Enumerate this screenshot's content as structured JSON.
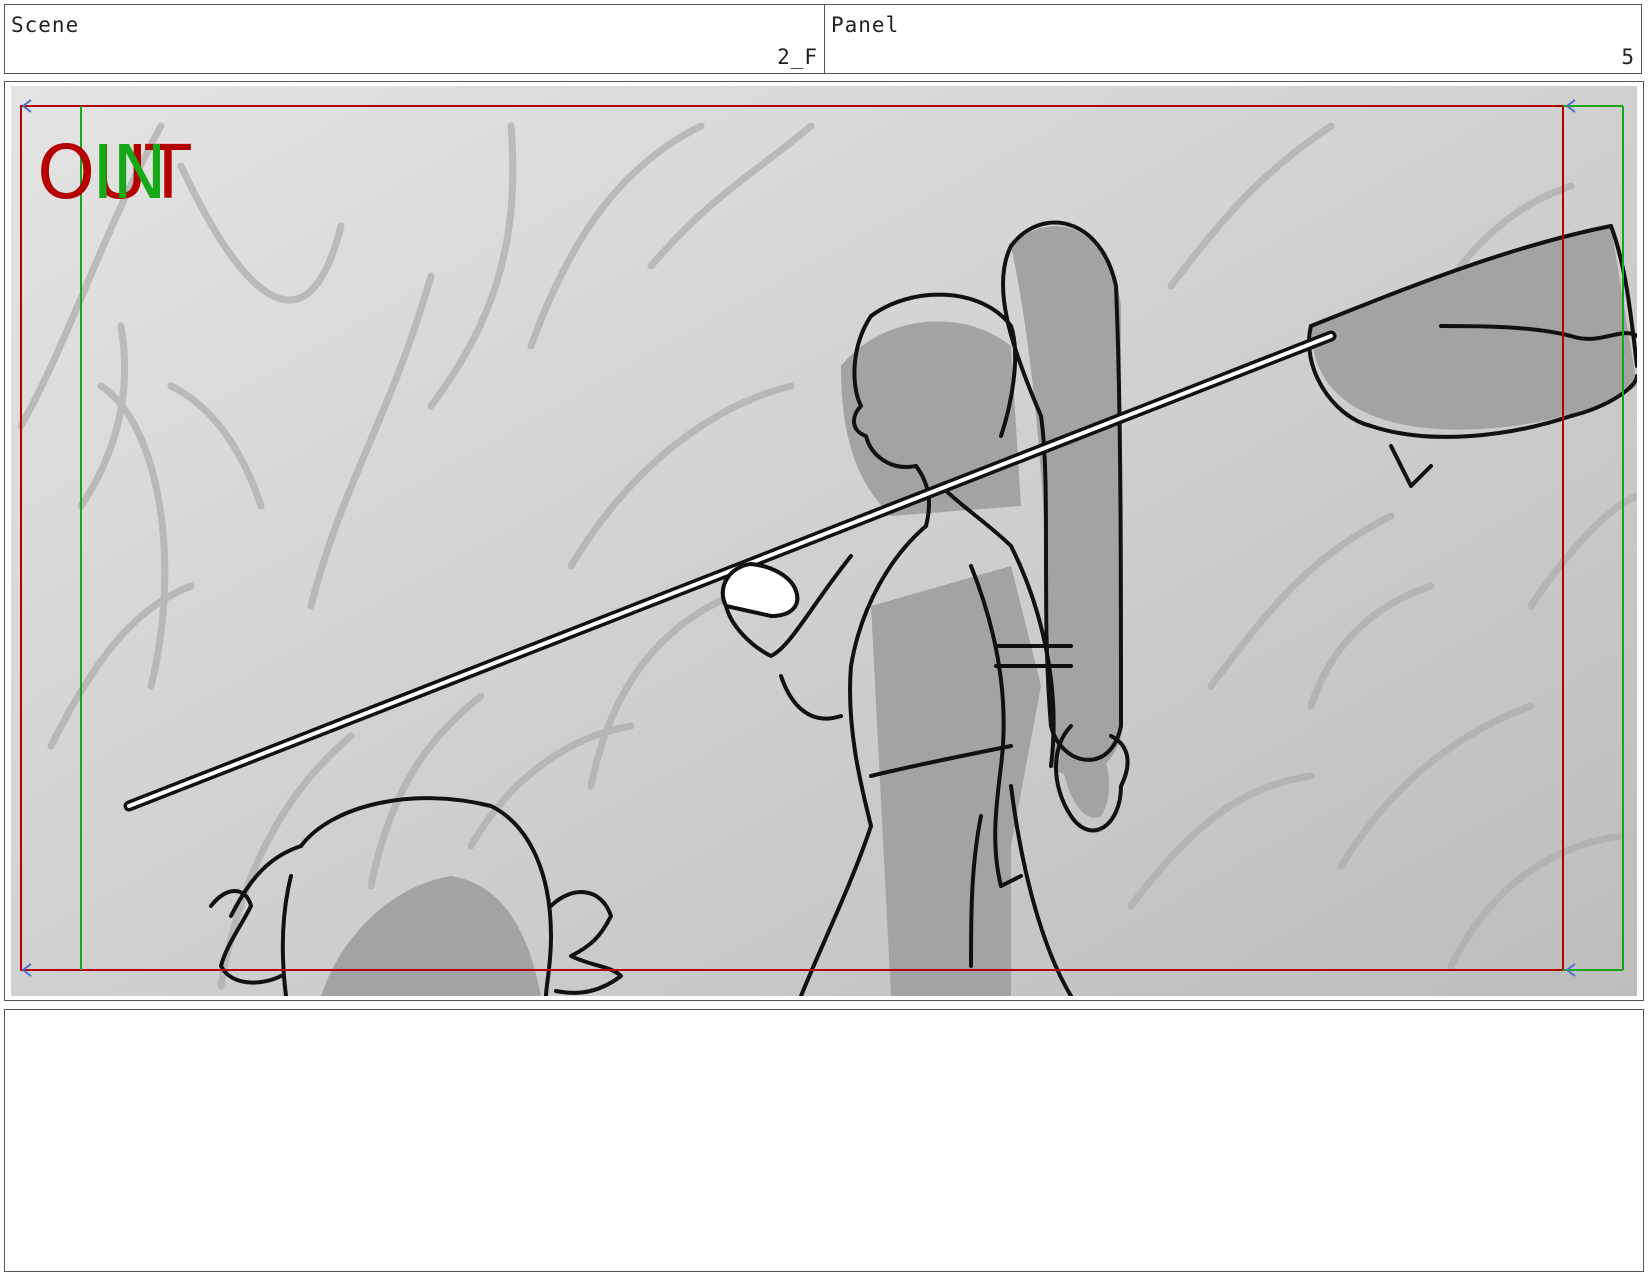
{
  "header": {
    "scene_label": "Scene",
    "scene_value": "2_F",
    "panel_label": "Panel",
    "panel_value": "5"
  },
  "frame": {
    "out_label": "OUT",
    "in_label": "IN",
    "colors": {
      "out_guide": "#b40000",
      "in_guide": "#16a816",
      "arrow": "#4a6fd6",
      "background_light": "#e2e2e2",
      "background_dark": "#c4c4c4",
      "shadow": "#a3a3a3",
      "line": "#111111"
    }
  },
  "notes": {
    "text": ""
  }
}
